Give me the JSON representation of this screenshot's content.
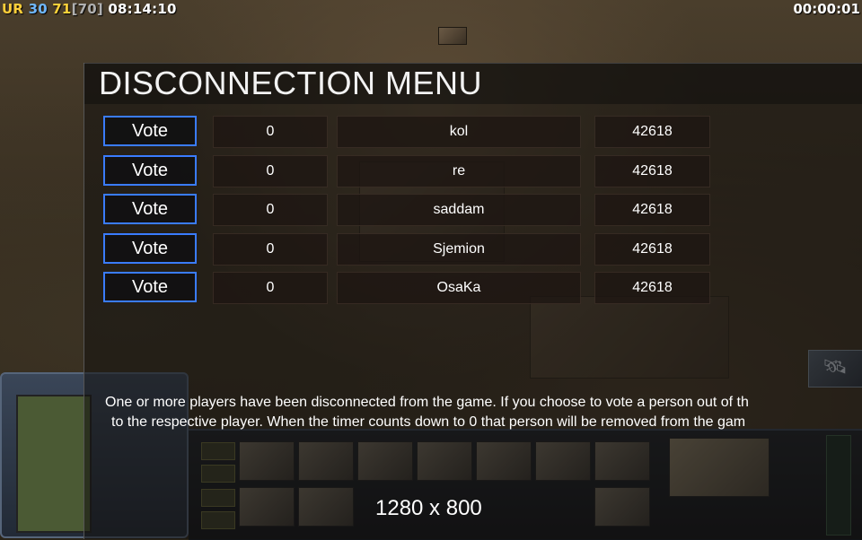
{
  "hud": {
    "faction": "UR",
    "stat_a": "30",
    "stat_b": "71",
    "stat_c": "[70]",
    "clock": "08:14:10",
    "timer": "00:00:01"
  },
  "menu": {
    "title": "DISCONNECTION MENU",
    "players": [
      {
        "vote_label": "Vote",
        "votes": "0",
        "name": "kol",
        "ping": "42618"
      },
      {
        "vote_label": "Vote",
        "votes": "0",
        "name": "re",
        "ping": "42618"
      },
      {
        "vote_label": "Vote",
        "votes": "0",
        "name": "saddam",
        "ping": "42618"
      },
      {
        "vote_label": "Vote",
        "votes": "0",
        "name": "Sjemion",
        "ping": "42618"
      },
      {
        "vote_label": "Vote",
        "votes": "0",
        "name": "OsaKa",
        "ping": "42618"
      }
    ],
    "info_line1": "One or more players have been disconnected from the game. If you choose to vote a person out of th",
    "info_line2": "to the respective player. When the timer counts down to 0 that person will be removed from the gam"
  },
  "overlay": {
    "resolution": "1280 x 800"
  },
  "colors": {
    "vote_border": "#3a7cff",
    "accent_yellow": "#ffd23a",
    "accent_blue": "#6fb7ff"
  },
  "icons": {
    "satellite": "satellite-icon"
  }
}
